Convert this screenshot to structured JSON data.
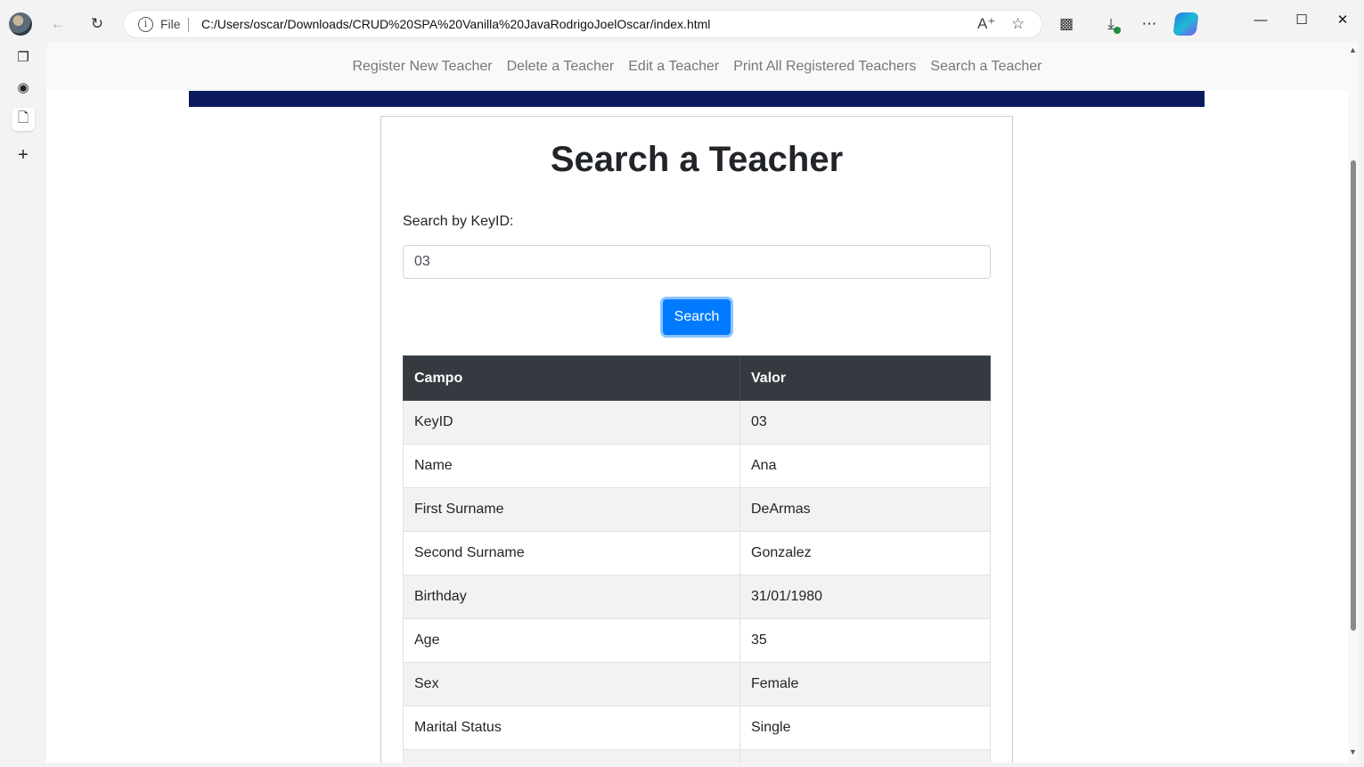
{
  "browser": {
    "address": {
      "scheme_label": "File",
      "url": "C:/Users/oscar/Downloads/CRUD%20SPA%20Vanilla%20JavaRodrigoJoelOscar/index.html"
    },
    "icons": [
      "avatar",
      "back-icon",
      "refresh-icon",
      "info-icon",
      "read-aloud-icon",
      "favorite-star-icon",
      "extensions-icon",
      "downloads-icon",
      "more-icon",
      "copilot-icon",
      "minimize-icon",
      "maximize-icon",
      "close-icon"
    ]
  },
  "sidebar": {
    "items": [
      {
        "name": "tab-actions-icon",
        "glyph": "❐"
      },
      {
        "name": "github-icon",
        "glyph": "◉"
      },
      {
        "name": "page-icon",
        "glyph": "🗋"
      },
      {
        "name": "add-icon",
        "glyph": "+"
      }
    ]
  },
  "nav": {
    "links": [
      "Register New Teacher",
      "Delete a Teacher",
      "Edit a Teacher",
      "Print All Registered Teachers",
      "Search a Teacher"
    ]
  },
  "page": {
    "title": "Search a Teacher",
    "search_label": "Search by KeyID:",
    "search_value": "03",
    "search_button": "Search"
  },
  "table": {
    "headers": [
      "Campo",
      "Valor"
    ],
    "rows": [
      [
        "KeyID",
        "03"
      ],
      [
        "Name",
        "Ana"
      ],
      [
        "First Surname",
        "DeArmas"
      ],
      [
        "Second Surname",
        "Gonzalez"
      ],
      [
        "Birthday",
        "31/01/1980"
      ],
      [
        "Age",
        "35"
      ],
      [
        "Sex",
        "Female"
      ],
      [
        "Marital Status",
        "Single"
      ]
    ]
  },
  "colors": {
    "hero_strip": "#0a1a5c",
    "button": "#007bff",
    "table_header": "#343a40"
  }
}
